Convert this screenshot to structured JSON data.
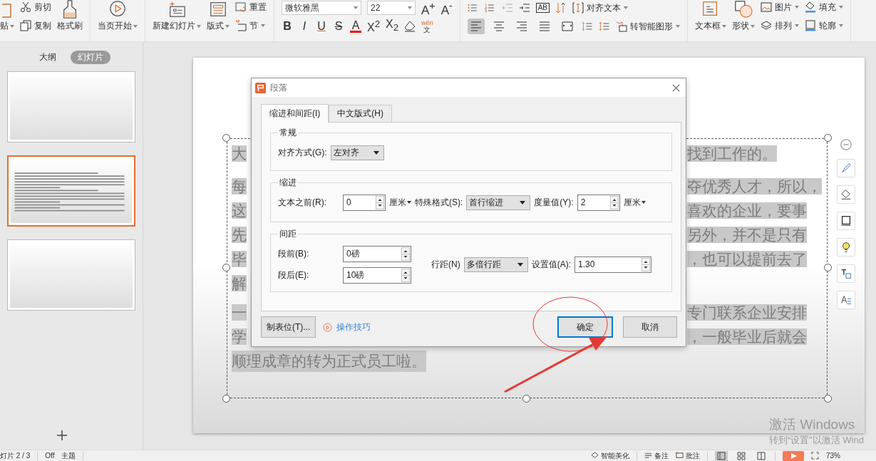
{
  "ribbon": {
    "clipboard": {
      "paste": "贴",
      "cut": "剪切",
      "copy": "复制",
      "format_painter": "格式刷"
    },
    "play_from_current": "当页开始",
    "slides": {
      "new_slide": "新建幻灯片",
      "layout": "版式",
      "reset": "重置",
      "section": "节"
    },
    "font": {
      "name": "微软雅黑",
      "size": "22",
      "grow": "A$^{+}$",
      "shrink": "A$^{-}$",
      "styles": [
        {
          "label": "B",
          "kind": "bold"
        },
        {
          "label": "I",
          "kind": "italic"
        },
        {
          "label": "U",
          "kind": "underline"
        },
        {
          "label": "S",
          "kind": "strike"
        },
        {
          "label": "A",
          "kind": "color"
        },
        {
          "label": "X$^{2}$",
          "kind": "plain"
        },
        {
          "label": "X$_{2}$",
          "kind": "plain"
        }
      ],
      "phonetic": {
        "pinyin": "wén",
        "char": "文"
      }
    },
    "paragraph": {
      "text_direction": "AB",
      "align": [
        {
          "selected": true
        },
        {
          "selected": false
        },
        {
          "selected": false
        },
        {
          "selected": false
        },
        {
          "selected": false
        }
      ]
    },
    "text": {
      "align_text": "对齐文本",
      "smart_art": "转智能图形"
    },
    "drawing": {
      "text_box": "文本框",
      "shape": "形状",
      "picture": "图片",
      "arrange": "排列",
      "fill": "填充",
      "outline": "轮廓"
    }
  },
  "side_panel": {
    "tabs": [
      {
        "label": "大纲",
        "selected": false
      },
      {
        "label": "幻灯片",
        "selected": true
      }
    ],
    "thumbnails": [
      {
        "selected": false,
        "kind": "blank"
      },
      {
        "selected": true,
        "kind": "text"
      },
      {
        "selected": false,
        "kind": "blank"
      }
    ]
  },
  "slide": {
    "paragraphs": [
      [
        {
          "kind": "split",
          "left": "大",
          "right": "找到工作的。"
        }
      ],
      [
        {
          "kind": "split",
          "left": "每",
          "right": "夺优秀人才，所以，"
        },
        {
          "kind": "split",
          "left": "这",
          "right": "喜欢的企业，要事"
        },
        {
          "kind": "split",
          "left": "先",
          "right": "另外，并不是只有"
        },
        {
          "kind": "split",
          "left": "毕",
          "right": "，也可以提前去了"
        },
        {
          "kind": "split",
          "left": "解"
        }
      ],
      [
        {
          "kind": "split",
          "left": "一",
          "right": "专门联系企业安排"
        },
        {
          "kind": "split",
          "left": "学",
          "right": "，一般毕业后就会"
        },
        {
          "kind": "full",
          "text": "顺理成章的转为正式员工啦。"
        }
      ]
    ]
  },
  "dialog": {
    "title": "段落",
    "tabs": [
      {
        "label": "缩进和间距(I)",
        "selected": true
      },
      {
        "label": "中文版式(H)",
        "selected": false
      }
    ],
    "general": {
      "title": "常规",
      "alignment": {
        "label": "对齐方式(G):",
        "value": "左对齐"
      }
    },
    "indent": {
      "title": "缩进",
      "before_text": {
        "label": "文本之前(R):",
        "value": "0",
        "unit": "厘米"
      },
      "special": {
        "label": "特殊格式(S):",
        "value": "首行缩进"
      },
      "by": {
        "label": "度量值(Y):",
        "value": "2",
        "unit": "厘米"
      }
    },
    "spacing": {
      "title": "间距",
      "before": {
        "label": "段前(B):",
        "value": "0磅"
      },
      "after": {
        "label": "段后(E):",
        "value": "10磅"
      },
      "line_spacing": {
        "label": "行距(N)",
        "value": "多倍行距"
      },
      "at": {
        "label": "设置值(A):",
        "value": "1.30"
      }
    },
    "tabs_button": "制表位(T)...",
    "tips_link": "操作技巧",
    "ok": {
      "label": "确定",
      "default": true
    },
    "cancel": "取消"
  },
  "status_bar": {
    "slide": "灯片 2 / 3",
    "theme_prefix": "Off",
    "theme": "主题",
    "beautify": "智能美化",
    "notes": "备注",
    "comments": "批注",
    "views": [
      {
        "selected": true
      },
      {
        "selected": false
      },
      {
        "selected": false
      }
    ],
    "zoom": "73%"
  },
  "activation": {
    "title": "激活 Windows",
    "hint": "转到“设置”以激活 Wind"
  }
}
